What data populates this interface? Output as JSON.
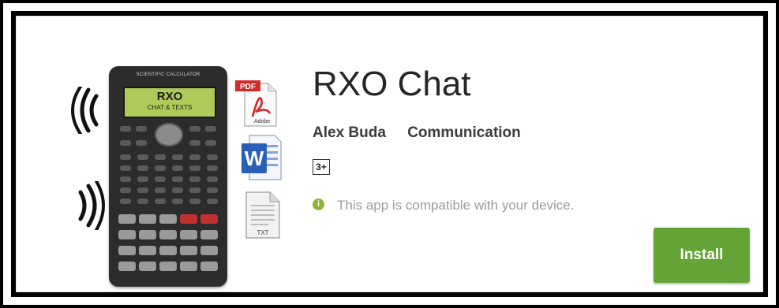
{
  "app": {
    "title": "RXO Chat",
    "developer": "Alex Buda",
    "category": "Communication",
    "content_rating": "3+",
    "compatibility_text": "This app is compatible with your device.",
    "install_label": "Install"
  },
  "artwork": {
    "calculator_brand": "SCIENTIFIC CALCULATOR",
    "screen_line1": "RXO",
    "screen_line2": "CHAT & TEXTS",
    "pdf_badge": "PDF",
    "adobe_label": "Adobe",
    "word_letter": "W",
    "txt_label": "TXT"
  },
  "colors": {
    "install_green": "#64a436",
    "info_icon_green": "#8bb532",
    "calculator_screen": "#aeca58",
    "pdf_red": "#d22b2b",
    "word_blue": "#2b5fb6"
  },
  "icons": [
    "sound-wave-icon",
    "pdf-file-icon",
    "word-file-icon",
    "txt-file-icon",
    "info-icon"
  ]
}
